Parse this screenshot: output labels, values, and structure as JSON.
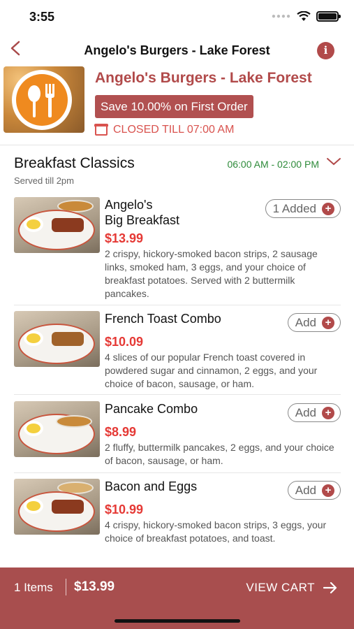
{
  "status": {
    "time": "3:55"
  },
  "nav": {
    "title": "Angelo's Burgers - Lake Forest",
    "back_icon": "chevron-left-icon",
    "info_icon": "info-icon"
  },
  "restaurant": {
    "name": "Angelo's Burgers - Lake Forest",
    "promo": "Save 10.00% on First Order",
    "status": "CLOSED TILL 07:00 AM",
    "accent": "#b14a4a"
  },
  "section": {
    "title": "Breakfast Classics",
    "subtitle": "Served till 2pm",
    "hours": "06:00 AM - 02:00 PM"
  },
  "items": [
    {
      "name_line1": "Angelo's",
      "name_line2": "Big Breakfast",
      "price": "$13.99",
      "description": "2 crispy, hickory-smoked bacon strips, 2 sausage links, smoked ham, 3 eggs, and your choice of breakfast potatoes. Served with 2 buttermilk pancakes.",
      "button": "1 Added"
    },
    {
      "name_line1": "French Toast Combo",
      "price": "$10.09",
      "description": "4 slices of our popular French toast covered in powdered sugar and cinnamon, 2 eggs, and your choice of bacon, sausage, or ham.",
      "button": "Add"
    },
    {
      "name_line1": "Pancake Combo",
      "price": "$8.99",
      "description": "2 fluffy, buttermilk pancakes, 2 eggs, and your choice of bacon, sausage, or ham.",
      "button": "Add"
    },
    {
      "name_line1": "Bacon and Eggs",
      "price": "$10.99",
      "description": "4 crispy, hickory-smoked bacon strips, 3 eggs, your choice of breakfast potatoes, and toast.",
      "button": "Add"
    }
  ],
  "cart": {
    "count": "1 Items",
    "total": "$13.99",
    "view_label": "VIEW CART"
  }
}
